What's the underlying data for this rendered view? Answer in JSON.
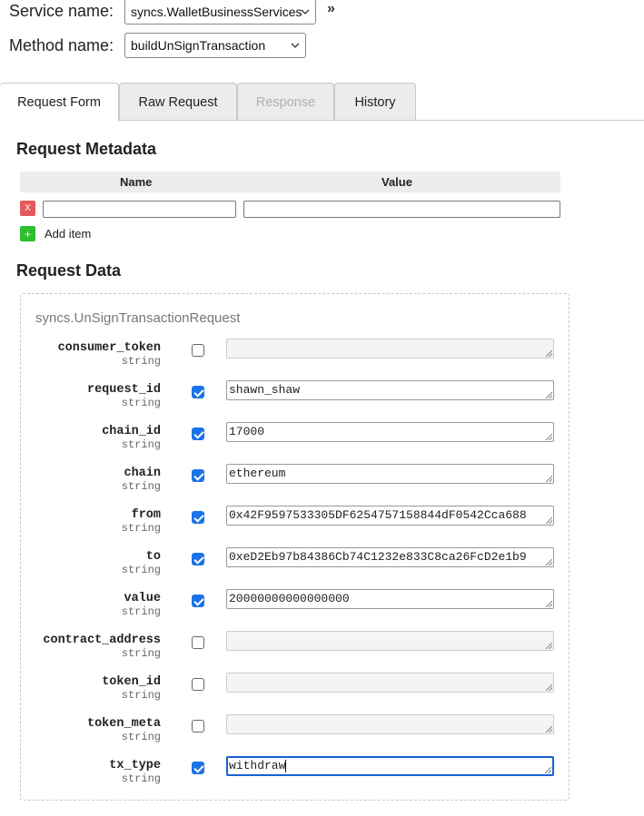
{
  "service": {
    "label": "Service name:",
    "value": "syncs.WalletBusinessServices"
  },
  "method": {
    "label": "Method name:",
    "value": "buildUnSignTransaction"
  },
  "expand_glyph": "»",
  "tabs": [
    {
      "label": "Request Form",
      "state": "active"
    },
    {
      "label": "Raw Request",
      "state": "inactive"
    },
    {
      "label": "Response",
      "state": "disabled"
    },
    {
      "label": "History",
      "state": "inactive"
    }
  ],
  "metadata": {
    "title": "Request Metadata",
    "col_name": "Name",
    "col_value": "Value",
    "remove_glyph": "X",
    "add_glyph": "+",
    "add_label": "Add item"
  },
  "request_data": {
    "title": "Request Data",
    "message_type": "syncs.UnSignTransactionRequest",
    "fields": [
      {
        "name": "consumer_token",
        "type": "string",
        "checked": false,
        "value": ""
      },
      {
        "name": "request_id",
        "type": "string",
        "checked": true,
        "value": "shawn_shaw"
      },
      {
        "name": "chain_id",
        "type": "string",
        "checked": true,
        "value": "17000"
      },
      {
        "name": "chain",
        "type": "string",
        "checked": true,
        "value": "ethereum"
      },
      {
        "name": "from",
        "type": "string",
        "checked": true,
        "value": "0x42F9597533305DF6254757158844dF0542Cca688"
      },
      {
        "name": "to",
        "type": "string",
        "checked": true,
        "value": "0xeD2Eb97b84386Cb74C1232e833C8ca26FcD2e1b9"
      },
      {
        "name": "value",
        "type": "string",
        "checked": true,
        "value": "20000000000000000"
      },
      {
        "name": "contract_address",
        "type": "string",
        "checked": false,
        "value": ""
      },
      {
        "name": "token_id",
        "type": "string",
        "checked": false,
        "value": ""
      },
      {
        "name": "token_meta",
        "type": "string",
        "checked": false,
        "value": ""
      },
      {
        "name": "tx_type",
        "type": "string",
        "checked": true,
        "value": "withdraw",
        "focused": true
      }
    ]
  },
  "colors": {
    "accent": "#1a73e8",
    "remove": "#e45b5b",
    "add": "#2ebd2e"
  }
}
